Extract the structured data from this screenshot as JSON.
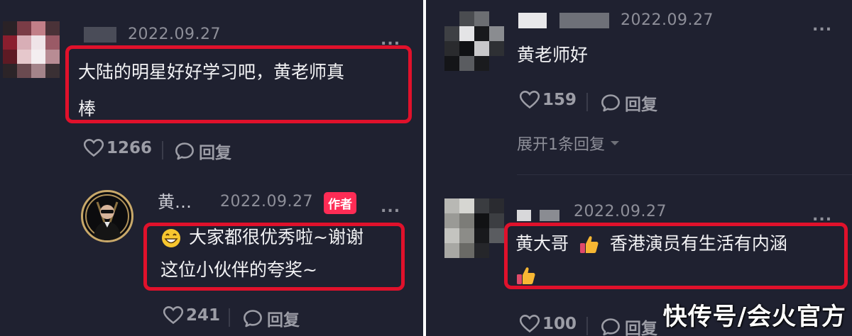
{
  "left": {
    "comment1": {
      "date": "2022.09.27",
      "more": "...",
      "line1": "大陆的明星好好学习吧，黄老师真",
      "line2": "棒",
      "likes": "1266",
      "reply": "回复"
    },
    "reply1": {
      "username": "黄…",
      "date": "2022.09.27",
      "badge": "作者",
      "more": "...",
      "line1": "大家都很优秀啦~谢谢",
      "line2": "这位小伙伴的夸奖~",
      "likes": "241",
      "reply": "回复"
    }
  },
  "right": {
    "comment1": {
      "date": "2022.09.27",
      "more": "...",
      "text": "黄老师好",
      "likes": "159",
      "reply": "回复",
      "expand": "展开1条回复"
    },
    "comment2": {
      "date": "2022.09.27",
      "more": "...",
      "line1a": "黄大哥",
      "line1b": "香港演员有生活有内涵",
      "likes": "100",
      "reply": "回复"
    }
  },
  "watermark": "快传号/会火官方",
  "colors": {
    "background": "#1f2130",
    "highlight_box": "#e0112b",
    "author_badge": "#fe2c55",
    "meta_text": "#8e8f99"
  },
  "icons": [
    "heart-icon",
    "comment-bubble-icon",
    "chevron-down-icon",
    "grinning-emoji-icon",
    "thumbs-up-emoji-icon"
  ]
}
